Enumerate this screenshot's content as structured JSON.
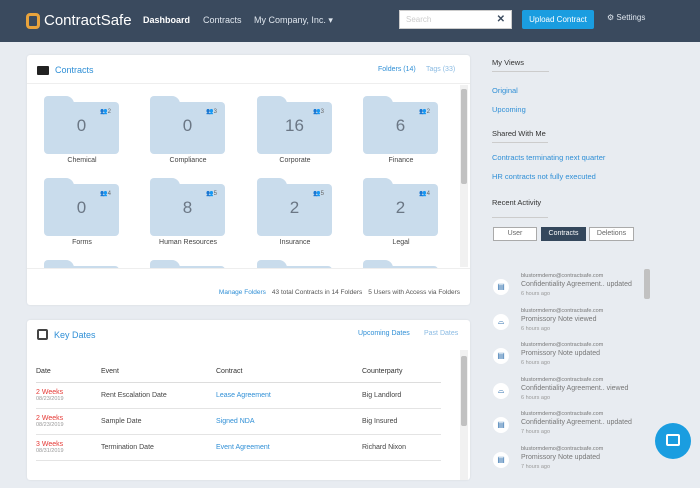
{
  "header": {
    "brand": "ContractSafe",
    "nav": [
      "Dashboard",
      "Contracts",
      "My Company, Inc. ▾"
    ],
    "search_placeholder": "Search",
    "upload": "Upload Contract",
    "settings": "Settings"
  },
  "contracts": {
    "title": "Contracts",
    "folders_link": "Folders (14)",
    "tags_link": "Tags (33)",
    "folders": [
      {
        "name": "Chemical",
        "count": "0",
        "users": "2"
      },
      {
        "name": "Compliance",
        "count": "0",
        "users": "3"
      },
      {
        "name": "Corporate",
        "count": "16",
        "users": "3"
      },
      {
        "name": "Finance",
        "count": "6",
        "users": "2"
      },
      {
        "name": "Forms",
        "count": "0",
        "users": "4"
      },
      {
        "name": "Human Resources",
        "count": "8",
        "users": "5"
      },
      {
        "name": "Insurance",
        "count": "2",
        "users": "5"
      },
      {
        "name": "Legal",
        "count": "2",
        "users": "4"
      }
    ],
    "manage": "Manage Folders",
    "total": "43 total Contracts in 14 Folders",
    "users": "5 Users with Access via Folders"
  },
  "key_dates": {
    "title": "Key Dates",
    "upcoming": "Upcoming Dates",
    "past": "Past Dates",
    "columns": [
      "Date",
      "Event",
      "Contract",
      "Counterparty"
    ],
    "rows": [
      {
        "rel": "2 Weeks",
        "date": "08/23/2019",
        "event": "Rent Escalation Date",
        "contract": "Lease Agreement",
        "party": "Big Landlord"
      },
      {
        "rel": "2 Weeks",
        "date": "08/23/2019",
        "event": "Sample Date",
        "contract": "Signed NDA",
        "party": "Big Insured"
      },
      {
        "rel": "3 Weeks",
        "date": "08/31/2019",
        "event": "Termination Date",
        "contract": "Event Agreement",
        "party": "Richard Nixon"
      }
    ]
  },
  "side": {
    "my_views": "My Views",
    "views": [
      "Original",
      "Upcoming"
    ],
    "shared": "Shared With Me",
    "shared_views": [
      "Contracts terminating next quarter",
      "HR contracts not fully executed"
    ],
    "recent": "Recent Activity",
    "tabs": [
      "User",
      "Contracts",
      "Deletions"
    ],
    "activity": [
      {
        "icon": "doc",
        "email": "blustormdemo@contractsafe.com",
        "text": "Confidentiality Agreement.. updated",
        "time": "6 hours ago"
      },
      {
        "icon": "view",
        "email": "blustormdemo@contractsafe.com",
        "text": "Promissory Note viewed",
        "time": "6 hours ago"
      },
      {
        "icon": "doc",
        "email": "blustormdemo@contractsafe.com",
        "text": "Promissory Note updated",
        "time": "6 hours ago"
      },
      {
        "icon": "view",
        "email": "blustormdemo@contractsafe.com",
        "text": "Confidentiality Agreement.. viewed",
        "time": "6 hours ago"
      },
      {
        "icon": "doc",
        "email": "blustormdemo@contractsafe.com",
        "text": "Confidentiality Agreement.. updated",
        "time": "7 hours ago"
      },
      {
        "icon": "doc",
        "email": "blustormdemo@contractsafe.com",
        "text": "Promissory Note updated",
        "time": "7 hours ago"
      }
    ]
  }
}
